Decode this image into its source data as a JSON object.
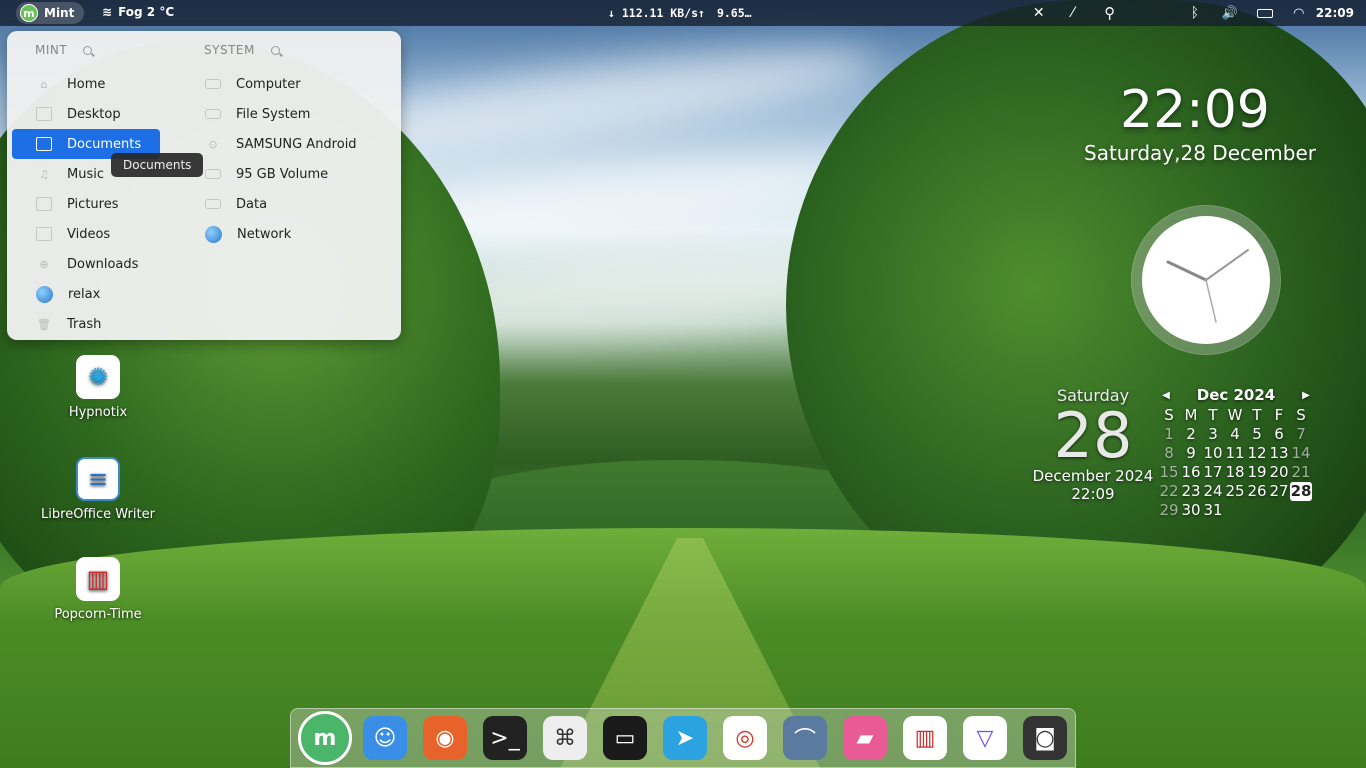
{
  "panel": {
    "menu_label": "Mint",
    "weather": "Fog 2 °C",
    "net_down": "↓ 112.11 KB/s↑",
    "net_up": "9.65…",
    "clock": "22:09"
  },
  "menu": {
    "left_header": "MINT",
    "right_header": "SYSTEM",
    "places": [
      {
        "label": "Home"
      },
      {
        "label": "Desktop"
      },
      {
        "label": "Documents"
      },
      {
        "label": "Music"
      },
      {
        "label": "Pictures"
      },
      {
        "label": "Videos"
      },
      {
        "label": "Downloads"
      },
      {
        "label": "relax"
      },
      {
        "label": "Trash"
      }
    ],
    "system": [
      {
        "label": "Computer"
      },
      {
        "label": "File System"
      },
      {
        "label": "SAMSUNG Android"
      },
      {
        "label": "95 GB Volume"
      },
      {
        "label": "Data"
      },
      {
        "label": "Network"
      }
    ],
    "tooltip": "Documents"
  },
  "desktop_icons": [
    {
      "label": "Hypnotix"
    },
    {
      "label": "LibreOffice Writer"
    },
    {
      "label": "Popcorn-Time"
    }
  ],
  "clock_desklet": {
    "time": "22:09",
    "date": "Saturday,28 December"
  },
  "date_desklet": {
    "weekday": "Saturday",
    "day": "28",
    "month_year": "December 2024",
    "time": "22:09"
  },
  "calendar": {
    "title": "Dec 2024",
    "weekdays": [
      "S",
      "M",
      "T",
      "W",
      "T",
      "F",
      "S"
    ],
    "rows": [
      [
        "1",
        "2",
        "3",
        "4",
        "5",
        "6",
        "7"
      ],
      [
        "8",
        "9",
        "10",
        "11",
        "12",
        "13",
        "14"
      ],
      [
        "15",
        "16",
        "17",
        "18",
        "19",
        "20",
        "21"
      ],
      [
        "22",
        "23",
        "24",
        "25",
        "26",
        "27",
        "28"
      ],
      [
        "29",
        "30",
        "31",
        "",
        "",
        "",
        ""
      ]
    ],
    "today": "28"
  },
  "dock": [
    {
      "name": "mint-menu-icon",
      "color": "#4bb56a"
    },
    {
      "name": "finder-icon",
      "color": "#3a8ee6"
    },
    {
      "name": "firefox-icon",
      "color": "#e8632b"
    },
    {
      "name": "terminal-icon",
      "color": "#222222"
    },
    {
      "name": "keyboard-shortcut-icon",
      "color": "#eeeeee"
    },
    {
      "name": "monitor-icon",
      "color": "#1a1a1a"
    },
    {
      "name": "telegram-icon",
      "color": "#2aa3e0"
    },
    {
      "name": "chrome-icon",
      "color": "#ffffff"
    },
    {
      "name": "heron-photo-icon",
      "color": "#5b7aa0"
    },
    {
      "name": "notes-app-icon",
      "color": "#e85b95"
    },
    {
      "name": "popcorn-time-icon",
      "color": "#ffffff"
    },
    {
      "name": "protonvpn-icon",
      "color": "#ffffff"
    },
    {
      "name": "screenshot-icon",
      "color": "#333333"
    }
  ]
}
